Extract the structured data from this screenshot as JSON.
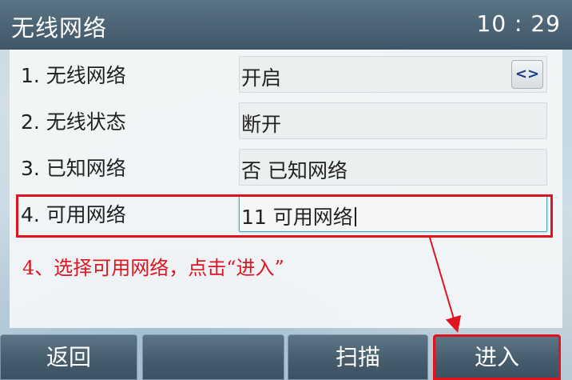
{
  "titlebar": {
    "title": "无线网络",
    "time": "10 : 29"
  },
  "rows": [
    {
      "label": "1. 无线网络",
      "value": "开启",
      "switch_glyph": "<>"
    },
    {
      "label": "2. 无线状态",
      "value": "断开"
    },
    {
      "label": "3. 已知网络",
      "value": "否 已知网络"
    },
    {
      "label": "4. 可用网络",
      "value": "11 可用网络"
    }
  ],
  "annotation": "4、选择可用网络，点击“进入”",
  "softkeys": {
    "back": "返回",
    "blank": "",
    "scan": "扫描",
    "enter": "进入"
  },
  "colors": {
    "annotation_red": "#e0141e",
    "titlebar": "#4a6374",
    "focus_border": "#52a6c9"
  }
}
